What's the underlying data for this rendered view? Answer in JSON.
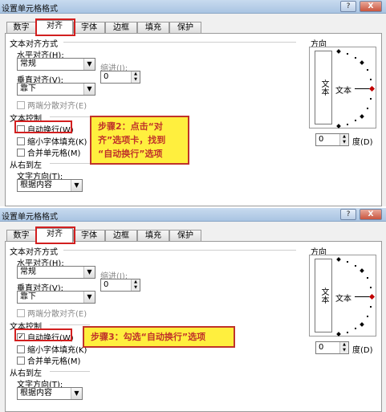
{
  "panels": [
    {
      "title": "设置单元格格式",
      "title_buttons": [
        "?",
        "X"
      ],
      "tabs": [
        "数字",
        "对齐",
        "字体",
        "边框",
        "填充",
        "保护"
      ],
      "active_tab": "对齐",
      "text_align_heading": "文本对齐方式",
      "h_align_label": "水平对齐(H):",
      "h_align_value": "常规",
      "indent_label": "缩进(I):",
      "indent_value": "0",
      "v_align_label": "垂直对齐(V):",
      "v_align_value": "靠下",
      "justify_distributed_label": "两端分散对齐(E)",
      "text_control_heading": "文本控制",
      "wrap_text_label": "自动换行(W)",
      "wrap_text_checked": false,
      "shrink_label": "缩小字体填充(K)",
      "merge_label": "合并单元格(M)",
      "rtl_heading": "从右到左",
      "direction_label": "文字方向(T):",
      "direction_value": "根据内容",
      "orientation_heading": "方向",
      "orientation_vertical_text": "文本",
      "orientation_text": "文本",
      "degree_value": "0",
      "degree_label": "度(D)",
      "callout": [
        "步骤2：点击“对",
        "齐”选项卡，找到",
        "“自动换行”选项"
      ]
    },
    {
      "title": "设置单元格格式",
      "title_buttons": [
        "?",
        "X"
      ],
      "tabs": [
        "数字",
        "对齐",
        "字体",
        "边框",
        "填充",
        "保护"
      ],
      "active_tab": "对齐",
      "text_align_heading": "文本对齐方式",
      "h_align_label": "水平对齐(H):",
      "h_align_value": "常规",
      "indent_label": "缩进(I):",
      "indent_value": "0",
      "v_align_label": "垂直对齐(V):",
      "v_align_value": "靠下",
      "justify_distributed_label": "两端分散对齐(E)",
      "text_control_heading": "文本控制",
      "wrap_text_label": "自动换行(W)",
      "wrap_text_checked": true,
      "shrink_label": "缩小字体填充(K)",
      "merge_label": "合并单元格(M)",
      "rtl_heading": "从右到左",
      "direction_label": "文字方向(T):",
      "direction_value": "根据内容",
      "orientation_heading": "方向",
      "orientation_vertical_text": "文本",
      "orientation_text": "文本",
      "degree_value": "0",
      "degree_label": "度(D)",
      "callout": [
        "步骤3：勾选“自动换行”选项"
      ]
    }
  ],
  "colors": {
    "highlight_border": "#d21f1f",
    "callout_bg": "#ffef3e",
    "callout_text": "#c0332a",
    "titlebar": "#b8cfe9"
  }
}
